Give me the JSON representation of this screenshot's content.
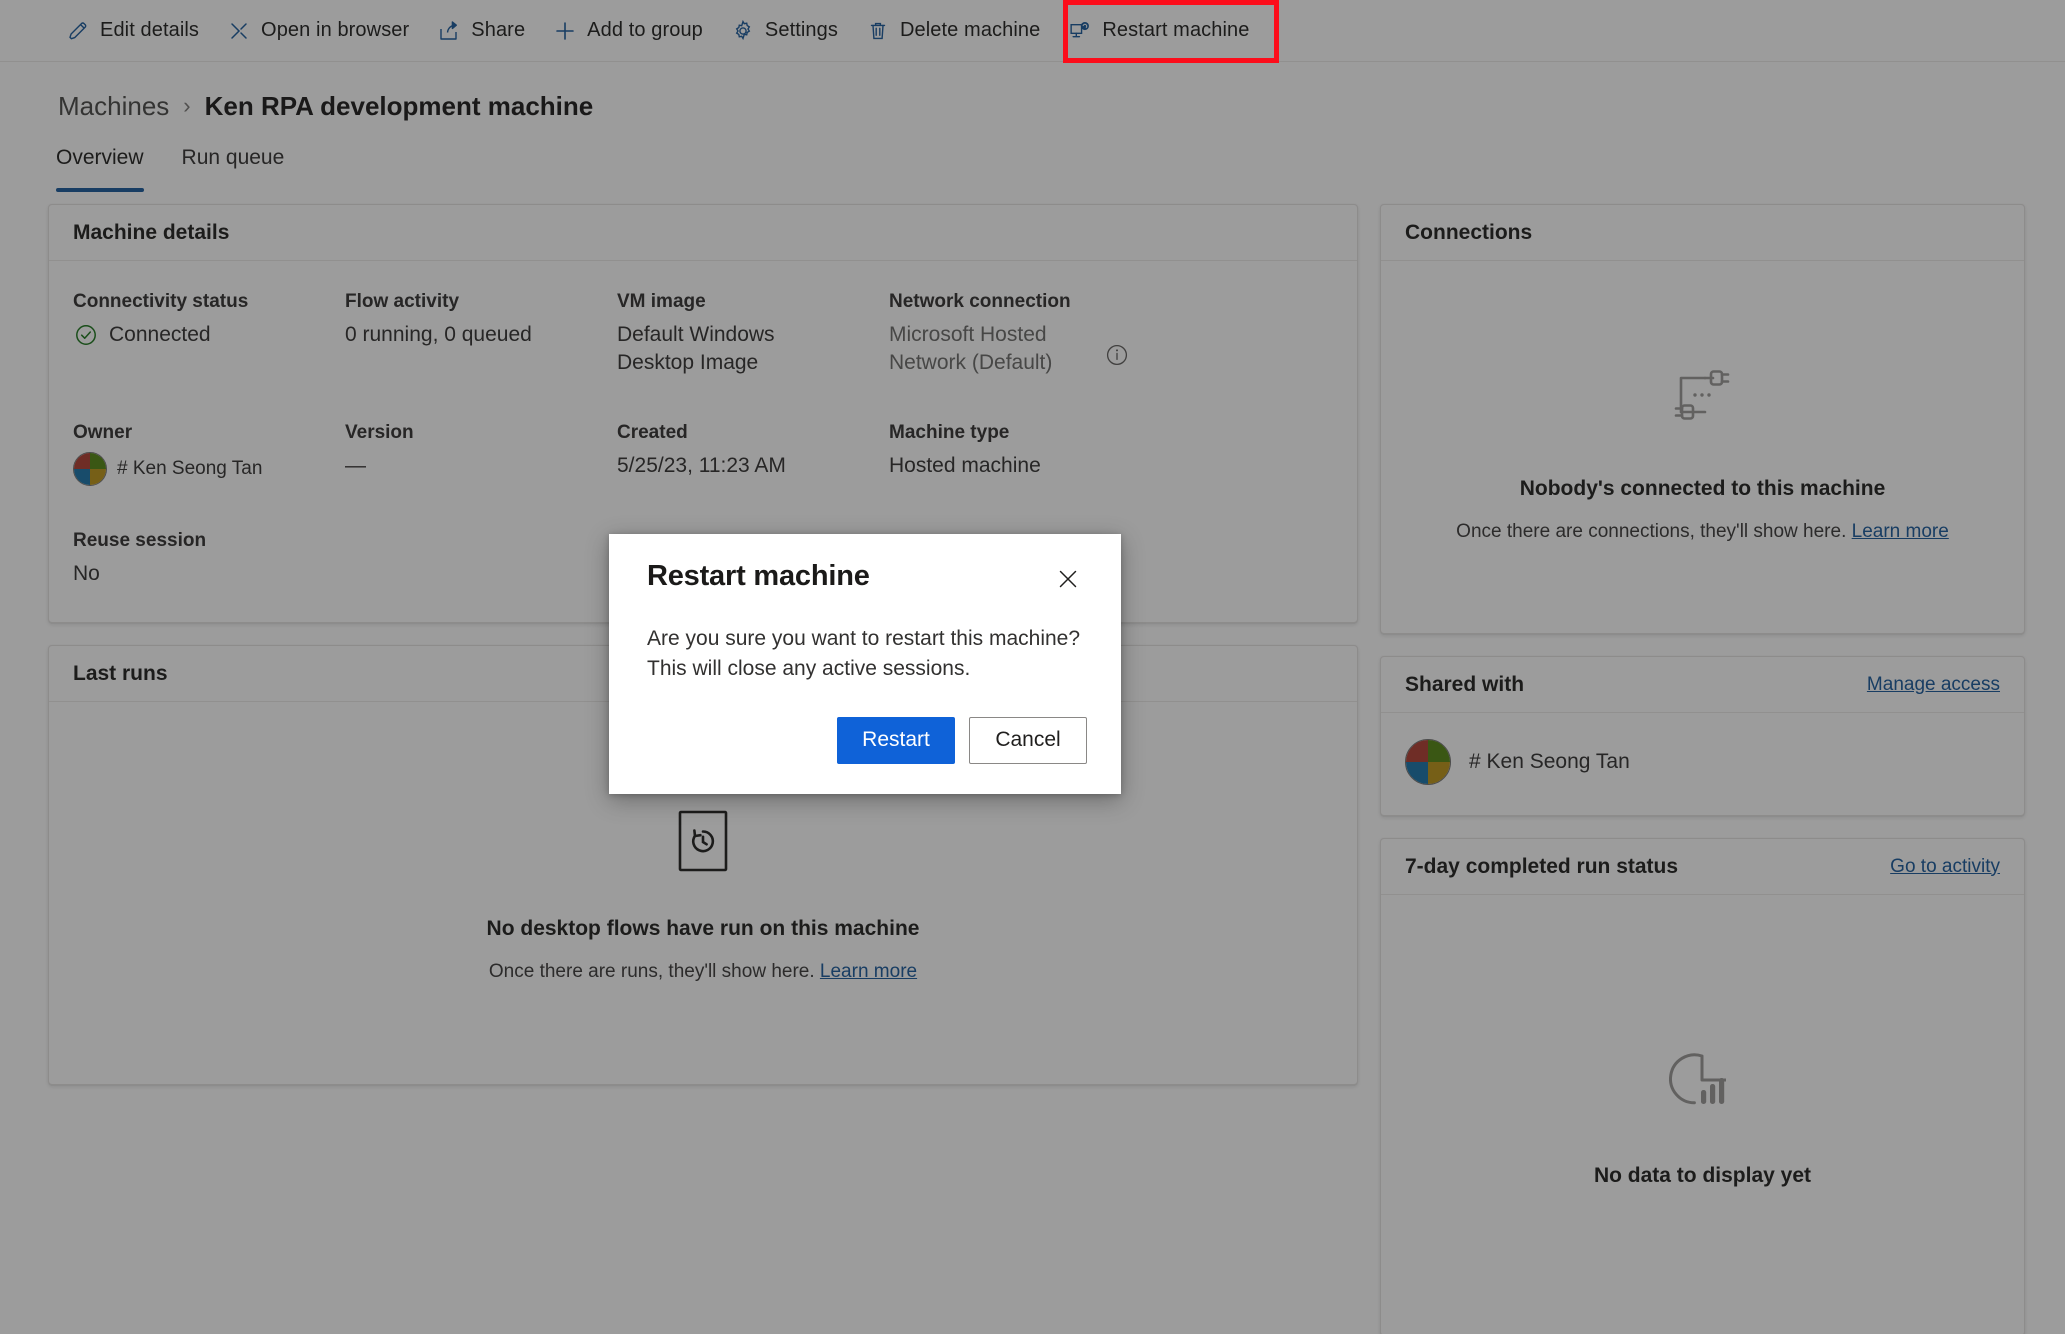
{
  "commandbar": {
    "items": [
      {
        "label": "Edit details",
        "icon": "pencil-icon"
      },
      {
        "label": "Open in browser",
        "icon": "open-in-browser-icon"
      },
      {
        "label": "Share",
        "icon": "share-icon"
      },
      {
        "label": "Add to group",
        "icon": "plus-icon"
      },
      {
        "label": "Settings",
        "icon": "gear-icon"
      },
      {
        "label": "Delete machine",
        "icon": "trash-icon"
      },
      {
        "label": "Restart machine",
        "icon": "restart-machine-icon"
      }
    ]
  },
  "breadcrumb": {
    "root": "Machines",
    "separator": "›",
    "current": "Ken RPA development machine"
  },
  "tabs": [
    {
      "label": "Overview",
      "active": true
    },
    {
      "label": "Run queue",
      "active": false
    }
  ],
  "machine_details": {
    "title": "Machine details",
    "fields": {
      "connectivity_status_label": "Connectivity status",
      "connectivity_status_value": "Connected",
      "flow_activity_label": "Flow activity",
      "flow_activity_value": "0 running, 0 queued",
      "vm_image_label": "VM image",
      "vm_image_value": "Default Windows Desktop Image",
      "network_connection_label": "Network connection",
      "network_connection_value": "Microsoft Hosted Network (Default)",
      "owner_label": "Owner",
      "owner_value": "# Ken Seong Tan",
      "version_label": "Version",
      "version_value": "—",
      "created_label": "Created",
      "created_value": "5/25/23, 11:23 AM",
      "machine_type_label": "Machine type",
      "machine_type_value": "Hosted machine",
      "reuse_session_label": "Reuse session",
      "reuse_session_value": "No"
    }
  },
  "last_runs": {
    "title": "Last runs",
    "empty_title": "No desktop flows have run on this machine",
    "empty_sub": "Once there are runs, they'll show here.",
    "empty_link": "Learn more",
    "icon": "history-clock-icon"
  },
  "connections": {
    "title": "Connections",
    "empty_title": "Nobody's connected to this machine",
    "empty_sub": "Once there are connections, they'll show here.",
    "empty_link": "Learn more",
    "icon": "plug-disconnected-icon"
  },
  "shared_with": {
    "title": "Shared with",
    "action_label": "Manage access",
    "person": "# Ken Seong Tan"
  },
  "run_status": {
    "title": "7-day completed run status",
    "action_label": "Go to activity",
    "empty_title": "No data to display yet",
    "icon": "pie-bar-chart-icon"
  },
  "dialog": {
    "title": "Restart machine",
    "message": "Are you sure you want to restart this machine? This will close any active sessions.",
    "confirm_label": "Restart",
    "cancel_label": "Cancel",
    "close_icon": "close-icon"
  },
  "highlight": {
    "target": "Restart machine",
    "color": "#fc0d1b"
  },
  "colors": {
    "accent": "#0f5ba8",
    "primary_button": "#0f62d8",
    "status_connected": "#107c10",
    "highlight": "#fc0d1b"
  }
}
